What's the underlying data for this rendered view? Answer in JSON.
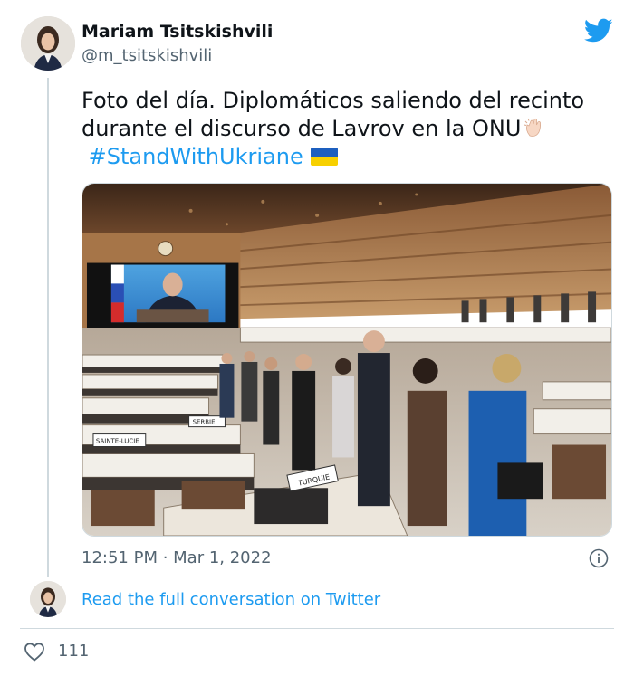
{
  "tweet": {
    "author_name": "Mariam Tsitskishvili",
    "author_handle": "@m_tsitskishvili",
    "text_line1": "Foto del día. Diplomáticos saliendo del recinto",
    "text_line2": "durante el discurso de Lavrov en la ONU",
    "hashtag": "#StandWithUkriane",
    "emoji_clap": "clapping-hands-emoji",
    "emoji_flag": "ukraine-flag-emoji",
    "timestamp": "12:51 PM · Mar 1, 2022",
    "read_more": "Read the full conversation on Twitter",
    "like_count": "111"
  },
  "photo": {
    "signs": [
      "TURQUIE",
      "SAINTE-LUCIE",
      "SERBIE"
    ]
  },
  "colors": {
    "link": "#1d9bf0",
    "secondary_text": "#536471",
    "divider": "#cfd9de"
  },
  "icons": [
    "twitter-bird-icon",
    "info-icon",
    "heart-icon"
  ]
}
